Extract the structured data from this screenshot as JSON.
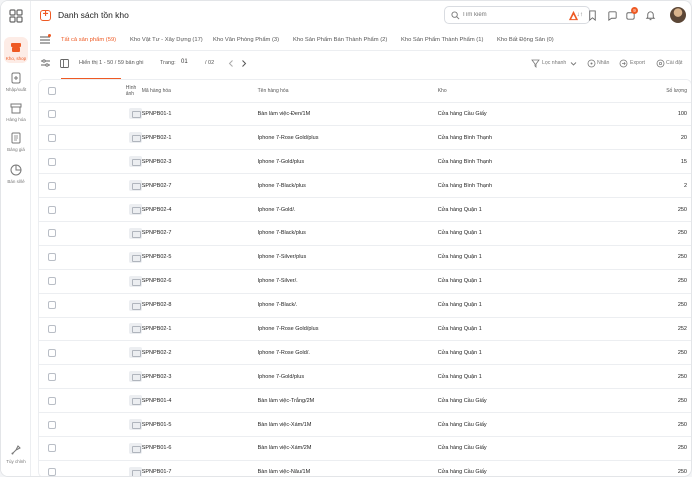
{
  "sidebar": {
    "items": [
      {
        "label": "Kho, shop",
        "icon": "store-icon",
        "active": true
      },
      {
        "label": "Nhập/xuất",
        "icon": "import-export-icon"
      },
      {
        "label": "Hàng hóa",
        "icon": "box-icon"
      },
      {
        "label": "Bảng giá",
        "icon": "price-list-icon"
      },
      {
        "label": "Bán sỉ/lẻ",
        "icon": "chart-icon"
      }
    ],
    "bottom_label": "Tùy chỉnh"
  },
  "header": {
    "title": "Danh sách tồn kho",
    "search_placeholder": "Tìm kiếm",
    "notification_count": "9"
  },
  "tabs": [
    {
      "label": "Tất cả sản phẩm (59)",
      "active": true
    },
    {
      "label": "Kho Vật Tư - Xây Dựng (17)"
    },
    {
      "label": "Kho Văn Phòng Phẩm (3)"
    },
    {
      "label": "Kho Sản Phẩm Bán Thành Phẩm (2)"
    },
    {
      "label": "Kho Sản Phẩm Thành Phẩm (1)"
    },
    {
      "label": "Kho Bất Động Sản (0)"
    }
  ],
  "toolbar": {
    "showing": "Hiển thị 1 - 50 / 59 bản ghi",
    "page_label": "Trang:",
    "page_current": "01",
    "page_total": "/ 02",
    "filter_label": "Lọc nhanh",
    "stamp_label": "Nhãn",
    "export_label": "Export",
    "settings_label": "Cài đặt"
  },
  "table": {
    "headers": {
      "image": "Hình ảnh",
      "code": "Mã hàng hóa",
      "name": "Tên hàng hóa",
      "warehouse": "Kho",
      "qty": "Số lượng"
    },
    "rows": [
      {
        "code": "SPNPB01-1",
        "name": "Bàn làm việc-Đen/1M",
        "warehouse": "Cửa hàng Cầu Giấy",
        "qty": "100"
      },
      {
        "code": "SPNPB02-1",
        "name": "Iphone 7-Rose Gold/plus",
        "warehouse": "Cửa hàng Bình Thạnh",
        "qty": "20"
      },
      {
        "code": "SPNPB02-3",
        "name": "Iphone 7-Gold/plus",
        "warehouse": "Cửa hàng Bình Thạnh",
        "qty": "15"
      },
      {
        "code": "SPNPB02-7",
        "name": "Iphone 7-Black/plus",
        "warehouse": "Cửa hàng Bình Thạnh",
        "qty": "2"
      },
      {
        "code": "SPNPB02-4",
        "name": "Iphone 7-Gold/.",
        "warehouse": "Cửa hàng Quận 1",
        "qty": "250"
      },
      {
        "code": "SPNPB02-7",
        "name": "Iphone 7-Black/plus",
        "warehouse": "Cửa hàng Quận 1",
        "qty": "250"
      },
      {
        "code": "SPNPB02-5",
        "name": "Iphone 7-Silver/plus",
        "warehouse": "Cửa hàng Quận 1",
        "qty": "250"
      },
      {
        "code": "SPNPB02-6",
        "name": "Iphone 7-Silver/.",
        "warehouse": "Cửa hàng Quận 1",
        "qty": "250"
      },
      {
        "code": "SPNPB02-8",
        "name": "Iphone 7-Black/.",
        "warehouse": "Cửa hàng Quận 1",
        "qty": "250"
      },
      {
        "code": "SPNPB02-1",
        "name": "Iphone 7-Rose Gold/plus",
        "warehouse": "Cửa hàng Quận 1",
        "qty": "252"
      },
      {
        "code": "SPNPB02-2",
        "name": "Iphone 7-Rose Gold/.",
        "warehouse": "Cửa hàng Quận 1",
        "qty": "250"
      },
      {
        "code": "SPNPB02-3",
        "name": "Iphone 7-Gold/plus",
        "warehouse": "Cửa hàng Quận 1",
        "qty": "250"
      },
      {
        "code": "SPNPB01-4",
        "name": "Bàn làm việc-Trắng/2M",
        "warehouse": "Cửa hàng Cầu Giấy",
        "qty": "250"
      },
      {
        "code": "SPNPB01-5",
        "name": "Bàn làm việc-Xám/1M",
        "warehouse": "Cửa hàng Cầu Giấy",
        "qty": "250"
      },
      {
        "code": "SPNPB01-6",
        "name": "Bàn làm việc-Xám/2M",
        "warehouse": "Cửa hàng Cầu Giấy",
        "qty": "250"
      },
      {
        "code": "SPNPB01-7",
        "name": "Bàn làm việc-Nâu/1M",
        "warehouse": "Cửa hàng Cầu Giấy",
        "qty": "250"
      }
    ]
  },
  "colors": {
    "accent": "#ee5a24",
    "border": "#eceef1"
  }
}
